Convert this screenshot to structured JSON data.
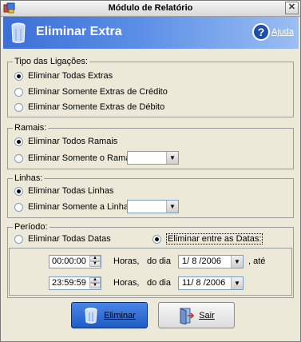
{
  "window": {
    "title": "Módulo de Relatório",
    "close_glyph": "✕"
  },
  "banner": {
    "title": "Eliminar Extra",
    "help_label": "Ajuda",
    "help_glyph": "?"
  },
  "tipo": {
    "title": "Tipo das Ligações:",
    "options": [
      {
        "label": "Eliminar Todas Extras",
        "selected": true
      },
      {
        "label": "Eliminar Somente Extras de Crédito",
        "selected": false
      },
      {
        "label": "Eliminar Somente Extras de Débito",
        "selected": false
      }
    ]
  },
  "ramais": {
    "title": "Ramais:",
    "options": [
      {
        "label": "Eliminar Todos Ramais",
        "selected": true
      },
      {
        "label": "Eliminar Somente o Ramal :",
        "selected": false
      }
    ],
    "combo_value": ""
  },
  "linhas": {
    "title": "Linhas:",
    "options": [
      {
        "label": "Eliminar Todas Linhas",
        "selected": true
      },
      {
        "label": "Eliminar Somente a Linha :",
        "selected": false
      }
    ],
    "combo_value": ""
  },
  "periodo": {
    "title": "Período:",
    "opt_all": {
      "label": "Eliminar Todas Datas",
      "selected": false
    },
    "opt_between": {
      "label": "Eliminar entre as Datas:",
      "selected": true
    },
    "row1": {
      "time": "00:00:00",
      "horas": "Horas,",
      "dodia": "do dia",
      "date": " 1/ 8 /2006",
      "suffix": ", até"
    },
    "row2": {
      "time": "23:59:59",
      "horas": "Horas,",
      "dodia": "do dia",
      "date": "11/ 8 /2006"
    }
  },
  "buttons": {
    "eliminar": "Eliminar",
    "sair": "Sair"
  },
  "colors": {
    "banner_start": "#3b6fd6",
    "banner_end": "#9bbef2",
    "face": "#ece9d8"
  }
}
